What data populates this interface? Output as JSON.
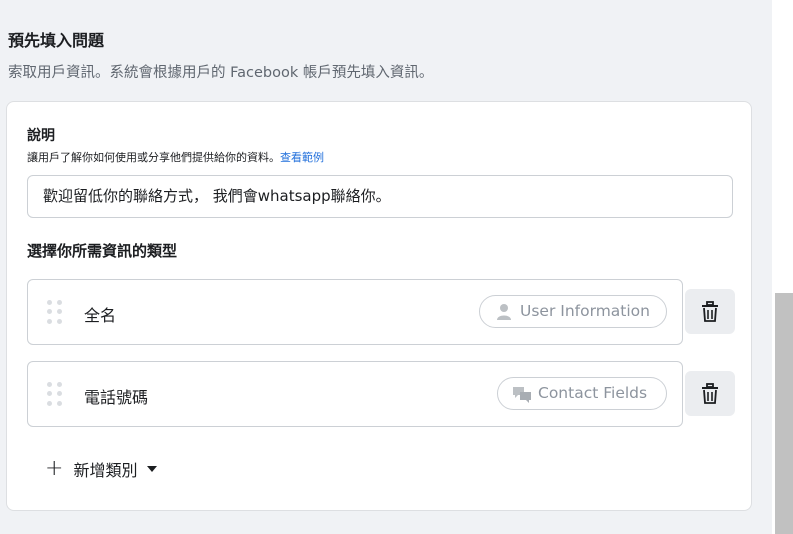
{
  "section": {
    "title": "預先填入問題",
    "subtitle": "索取用戶資訊。系統會根據用戶的 Facebook 帳戶預先填入資訊。"
  },
  "description": {
    "label": "說明",
    "help_text": "讓用戶了解你如何使用或分享他們提供給你的資料。",
    "help_link": "查看範例",
    "value": "歡迎留低你的聯絡方式， 我們會whatsapp聯絡你。"
  },
  "types": {
    "label": "選擇你所需資訊的類型",
    "rows": [
      {
        "label": "全名",
        "tag": "User Information",
        "tag_icon": "person-icon"
      },
      {
        "label": "電話號碼",
        "tag": "Contact Fields",
        "tag_icon": "chat-bubbles-icon"
      }
    ],
    "add_category": "新增類別"
  },
  "colors": {
    "link": "#216fdb",
    "muted": "#8d949e",
    "border": "#ccd0d5"
  }
}
